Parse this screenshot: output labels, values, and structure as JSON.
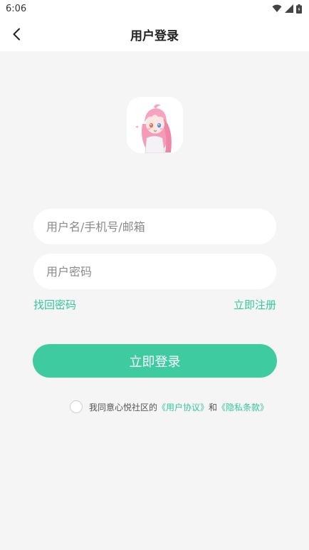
{
  "status_bar": {
    "time": "6:06",
    "icons": [
      "wifi-icon",
      "signal-icon",
      "battery-icon"
    ]
  },
  "nav": {
    "title": "用户登录",
    "back_icon": "chevron-left-icon"
  },
  "logo": {
    "description_icon": "anime-avatar-logo"
  },
  "form": {
    "username_placeholder": "用户名/手机号/邮箱",
    "username_value": "",
    "password_placeholder": "用户密码",
    "password_value": ""
  },
  "links": {
    "forgot_password": "找回密码",
    "register": "立即注册"
  },
  "login_button": "立即登录",
  "agreement": {
    "checked": false,
    "prefix": "我同意心悦社区的",
    "user_agreement": "《用户协议》",
    "conjunction": "和",
    "privacy_policy": "《隐私条款》"
  },
  "colors": {
    "accent": "#3ecb9f",
    "link": "#34c79e",
    "background": "#f5f5f5"
  }
}
